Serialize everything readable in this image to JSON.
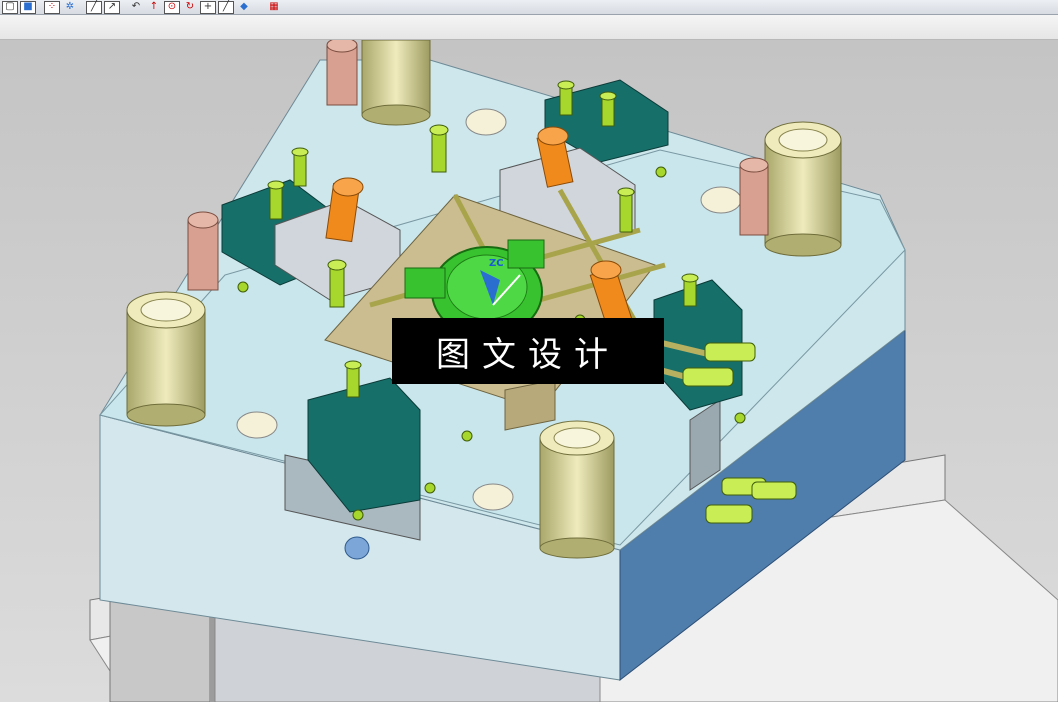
{
  "toolbar": {
    "buttons": [
      {
        "name": "wireframe-box-icon"
      },
      {
        "name": "shaded-box-icon"
      },
      {
        "name": "snap-point-icon"
      },
      {
        "name": "snap-mid-icon"
      },
      {
        "name": "line-icon"
      },
      {
        "name": "line-arrow-icon"
      },
      {
        "name": "arc-icon"
      },
      {
        "name": "up-arrow-icon"
      },
      {
        "name": "point-on-circle-icon"
      },
      {
        "name": "rotate-icon"
      },
      {
        "name": "plus-icon"
      },
      {
        "name": "diagonal-line-icon"
      },
      {
        "name": "cube-icon"
      },
      {
        "name": "grid-icon"
      }
    ]
  },
  "viewport": {
    "triad_label": "ZC",
    "watermark": "图文设计"
  },
  "colors": {
    "plate_light": "#cfe6ea",
    "plate_side": "#4f7dac",
    "slider_teal": "#176f6a",
    "guide_bushing": "#e8e4b0",
    "spring_yellow": "#f2e000",
    "cavity_green": "#38c22f",
    "pin_orange": "#f08a1c"
  }
}
